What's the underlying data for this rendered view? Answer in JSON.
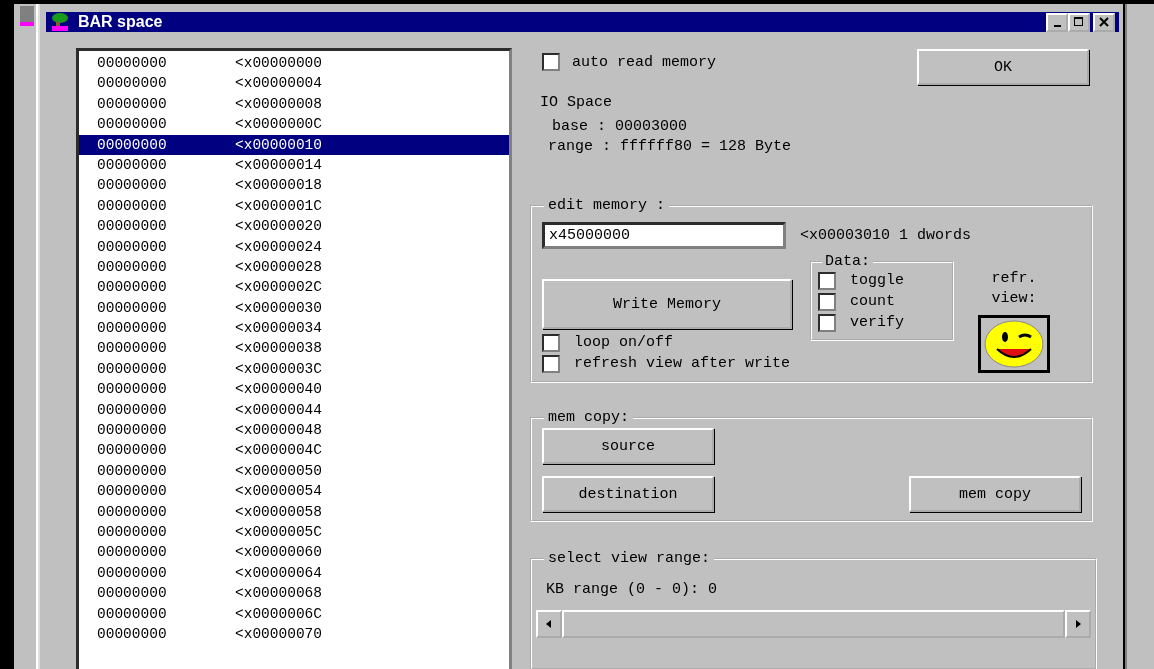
{
  "window": {
    "title": "BAR space"
  },
  "memory_list": {
    "rows": [
      {
        "value": "00000000",
        "address": "<x00000000",
        "selected": false
      },
      {
        "value": "00000000",
        "address": "<x00000004",
        "selected": false
      },
      {
        "value": "00000000",
        "address": "<x00000008",
        "selected": false
      },
      {
        "value": "00000000",
        "address": "<x0000000C",
        "selected": false
      },
      {
        "value": "00000000",
        "address": "<x00000010",
        "selected": true
      },
      {
        "value": "00000000",
        "address": "<x00000014",
        "selected": false
      },
      {
        "value": "00000000",
        "address": "<x00000018",
        "selected": false
      },
      {
        "value": "00000000",
        "address": "<x0000001C",
        "selected": false
      },
      {
        "value": "00000000",
        "address": "<x00000020",
        "selected": false
      },
      {
        "value": "00000000",
        "address": "<x00000024",
        "selected": false
      },
      {
        "value": "00000000",
        "address": "<x00000028",
        "selected": false
      },
      {
        "value": "00000000",
        "address": "<x0000002C",
        "selected": false
      },
      {
        "value": "00000000",
        "address": "<x00000030",
        "selected": false
      },
      {
        "value": "00000000",
        "address": "<x00000034",
        "selected": false
      },
      {
        "value": "00000000",
        "address": "<x00000038",
        "selected": false
      },
      {
        "value": "00000000",
        "address": "<x0000003C",
        "selected": false
      },
      {
        "value": "00000000",
        "address": "<x00000040",
        "selected": false
      },
      {
        "value": "00000000",
        "address": "<x00000044",
        "selected": false
      },
      {
        "value": "00000000",
        "address": "<x00000048",
        "selected": false
      },
      {
        "value": "00000000",
        "address": "<x0000004C",
        "selected": false
      },
      {
        "value": "00000000",
        "address": "<x00000050",
        "selected": false
      },
      {
        "value": "00000000",
        "address": "<x00000054",
        "selected": false
      },
      {
        "value": "00000000",
        "address": "<x00000058",
        "selected": false
      },
      {
        "value": "00000000",
        "address": "<x0000005C",
        "selected": false
      },
      {
        "value": "00000000",
        "address": "<x00000060",
        "selected": false
      },
      {
        "value": "00000000",
        "address": "<x00000064",
        "selected": false
      },
      {
        "value": "00000000",
        "address": "<x00000068",
        "selected": false
      },
      {
        "value": "00000000",
        "address": "<x0000006C",
        "selected": false
      },
      {
        "value": "00000000",
        "address": "<x00000070",
        "selected": false
      }
    ]
  },
  "auto_read": {
    "label": "auto read memory",
    "checked": false
  },
  "ok_button": "OK",
  "io_info": {
    "title": "IO Space",
    "base": "base : 00003000",
    "range": "range : ffffff80 = 128 Byte"
  },
  "edit_memory": {
    "title": "edit memory :",
    "value": "x45000000",
    "address_label": "<x00003010 1 dwords",
    "write_button": "Write Memory",
    "data_group": {
      "title": "Data:",
      "options": [
        {
          "label": "toggle",
          "checked": false
        },
        {
          "label": "count",
          "checked": false
        },
        {
          "label": "verify",
          "checked": false
        }
      ]
    },
    "refresh_label": [
      "refr.",
      "view:"
    ],
    "options": [
      {
        "label": "loop on/off",
        "checked": false
      },
      {
        "label": "refresh view after write",
        "checked": false
      }
    ]
  },
  "mem_copy": {
    "title": "mem copy:",
    "source_button": "source",
    "destination_button": "destination",
    "copy_button": "mem copy"
  },
  "view_range": {
    "title": "select view range:",
    "label": "KB range (0 - 0): 0"
  }
}
